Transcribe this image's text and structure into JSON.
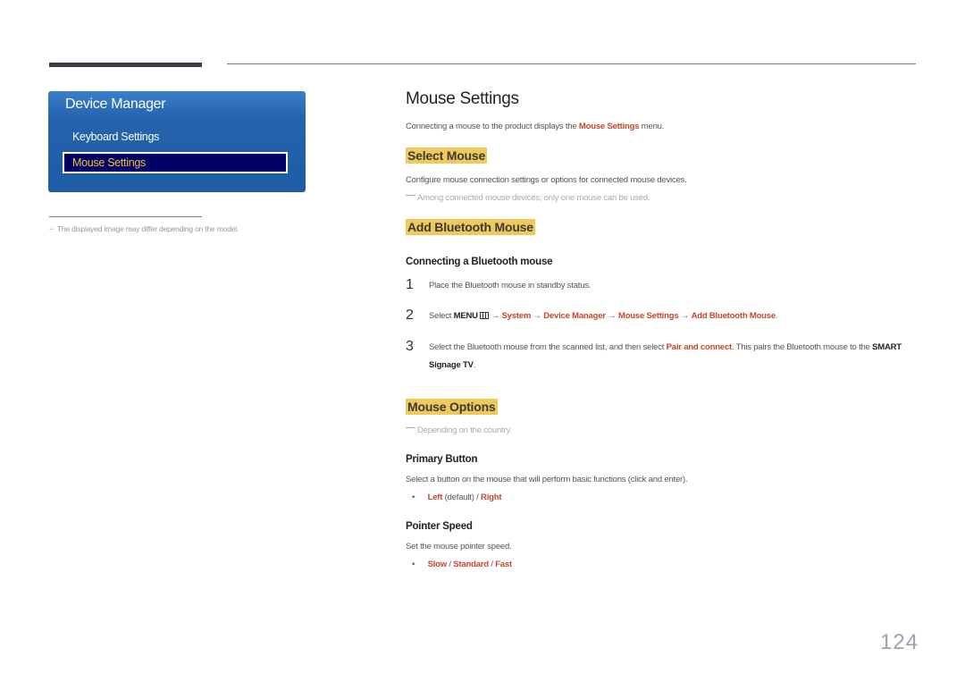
{
  "sidebar": {
    "menu_title": "Device Manager",
    "menu_items": [
      {
        "label": "Keyboard Settings",
        "selected": false
      },
      {
        "label": "Mouse Settings",
        "selected": true
      }
    ],
    "footnote": "The displayed image may differ depending on the model.",
    "footnote_marker": "−"
  },
  "main": {
    "title": "Mouse Settings",
    "intro": {
      "before": "Connecting a mouse to the product displays the ",
      "highlight": "Mouse Settings",
      "after": " menu."
    },
    "select_mouse": {
      "heading": "Select Mouse",
      "description": "Configure mouse connection settings or options for connected mouse devices.",
      "note": "Among connected mouse devices, only one mouse can be used."
    },
    "add_bluetooth": {
      "heading": "Add Bluetooth Mouse",
      "subheading": "Connecting a Bluetooth mouse",
      "steps": [
        {
          "num": "1",
          "text": "Place the Bluetooth mouse in standby status."
        },
        {
          "num": "2",
          "prefix": "Select ",
          "menu": "MENU",
          "arrow": " → ",
          "path": [
            "System",
            "Device Manager",
            "Mouse Settings",
            "Add Bluetooth Mouse"
          ],
          "suffix": "."
        },
        {
          "num": "3",
          "before": "Select the Bluetooth mouse from the scanned list, and then select ",
          "highlight": "Pair and connect",
          "middle": ". This pairs the Bluetooth mouse to the ",
          "bold": "SMART Signage TV",
          "after": "."
        }
      ]
    },
    "mouse_options": {
      "heading": "Mouse Options",
      "note": "Depending on the country.",
      "primary_button": {
        "heading": "Primary Button",
        "description": "Select a button on the mouse that will perform basic functions (click and enter).",
        "opt1": "Left",
        "opt1_suffix": " (default) / ",
        "opt2": "Right"
      },
      "pointer_speed": {
        "heading": "Pointer Speed",
        "description": "Set the mouse pointer speed.",
        "options": [
          "Slow",
          "Standard",
          "Fast"
        ],
        "separator": " / "
      }
    }
  },
  "page_number": "124",
  "colors": {
    "accent_red": "#c8462a",
    "highlight_yellow": "#f0c95a",
    "menu_blue": "#2563ad",
    "menu_selected": "#000066",
    "selected_text": "#f5c232"
  }
}
